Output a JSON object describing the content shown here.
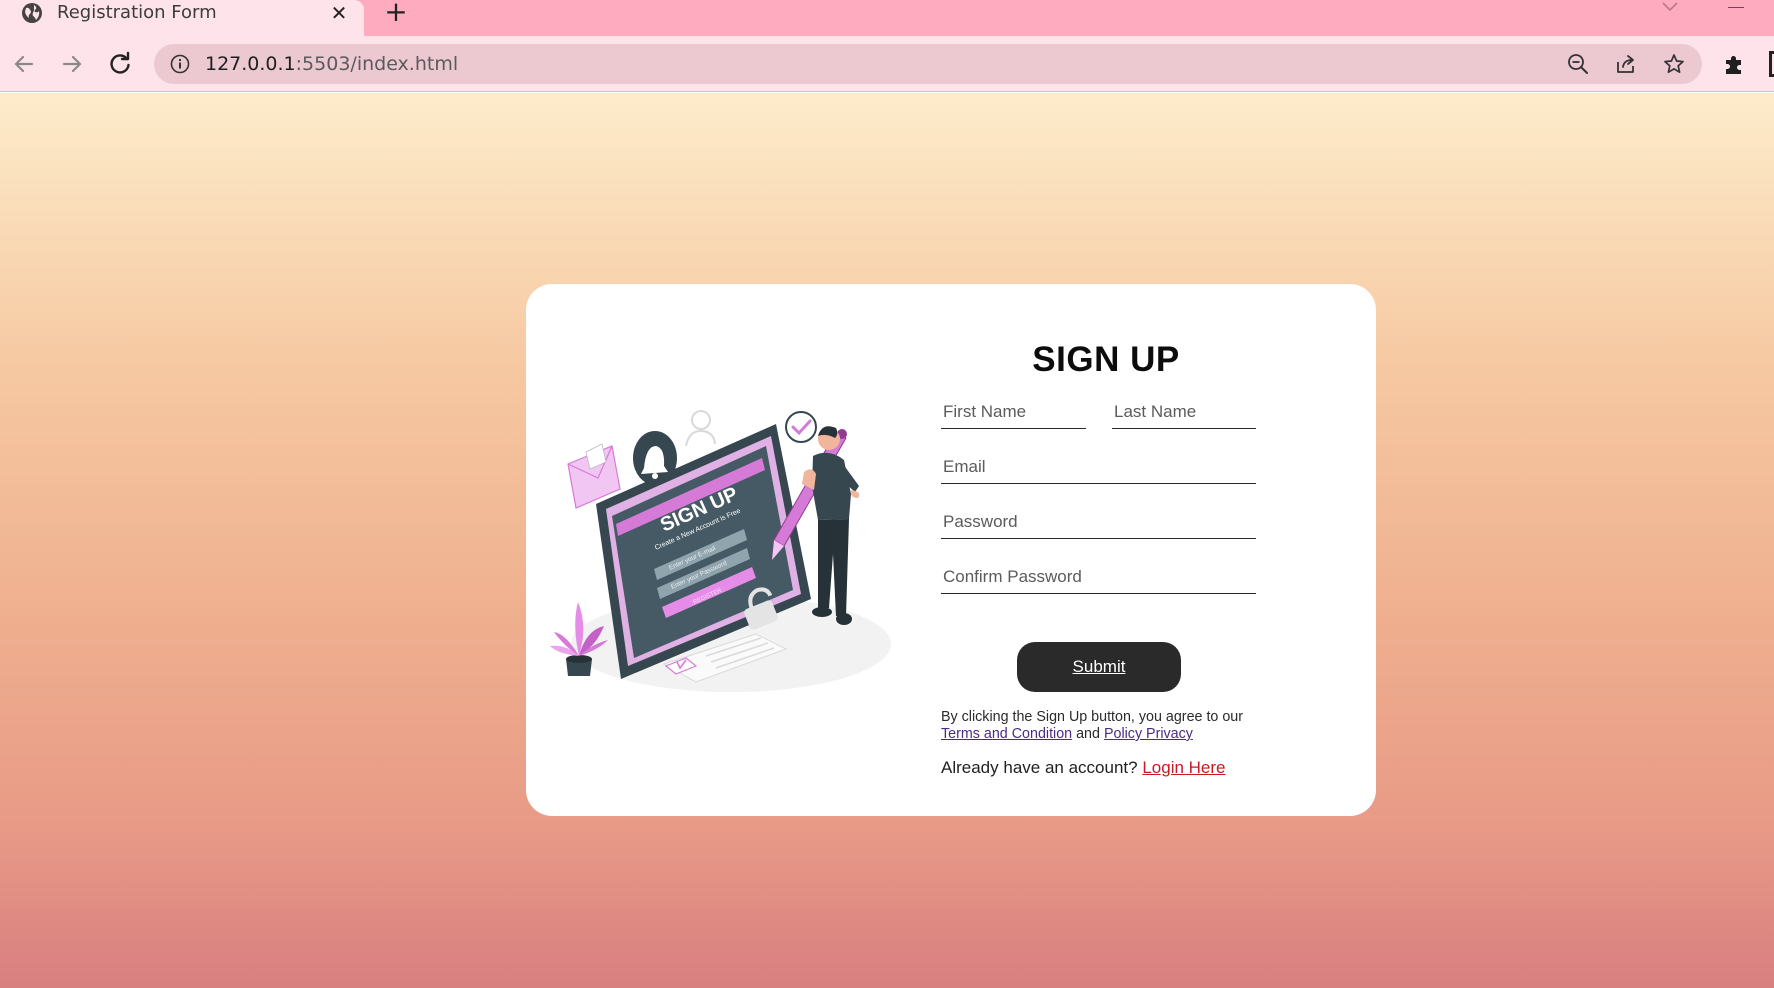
{
  "browser": {
    "tab_title": "Registration Form",
    "new_tab_symbol": "+",
    "close_symbol": "✕",
    "url_host": "127.0.0.1",
    "url_rest": ":5503/index.html",
    "icons": [
      "globe-icon",
      "close-icon",
      "plus-icon",
      "chevron-down-icon",
      "back-icon",
      "forward-icon",
      "reload-icon",
      "info-icon",
      "zoom-out-icon",
      "share-icon",
      "star-icon",
      "puzzle-icon"
    ]
  },
  "illustration": {
    "screen_title": "SIGN UP",
    "screen_subtitle": "Create a New Account is Free",
    "field_1": "Enter your E-mail",
    "field_2": "Enter your Password",
    "button": "REGISTER",
    "accent_color": "#d67ad8"
  },
  "form": {
    "heading": "SIGN UP",
    "first_name_placeholder": "First Name",
    "last_name_placeholder": "Last Name",
    "email_placeholder": "Email",
    "password_placeholder": "Password",
    "confirm_password_placeholder": "Confirm Password",
    "submit_label": "Submit",
    "terms_prefix": "By clicking the Sign Up button, you agree to our",
    "terms_link": "Terms and Condition",
    "terms_and": "and",
    "privacy_link": "Policy Privacy",
    "login_prompt": "Already have an account?",
    "login_link": "Login Here"
  },
  "colors": {
    "tabstrip": "#ffabbf",
    "toolbar": "#ffe3ea",
    "card": "#ffffff",
    "button": "#2a2a2a",
    "link": "#4a2c83",
    "login_link": "#c61b23"
  }
}
